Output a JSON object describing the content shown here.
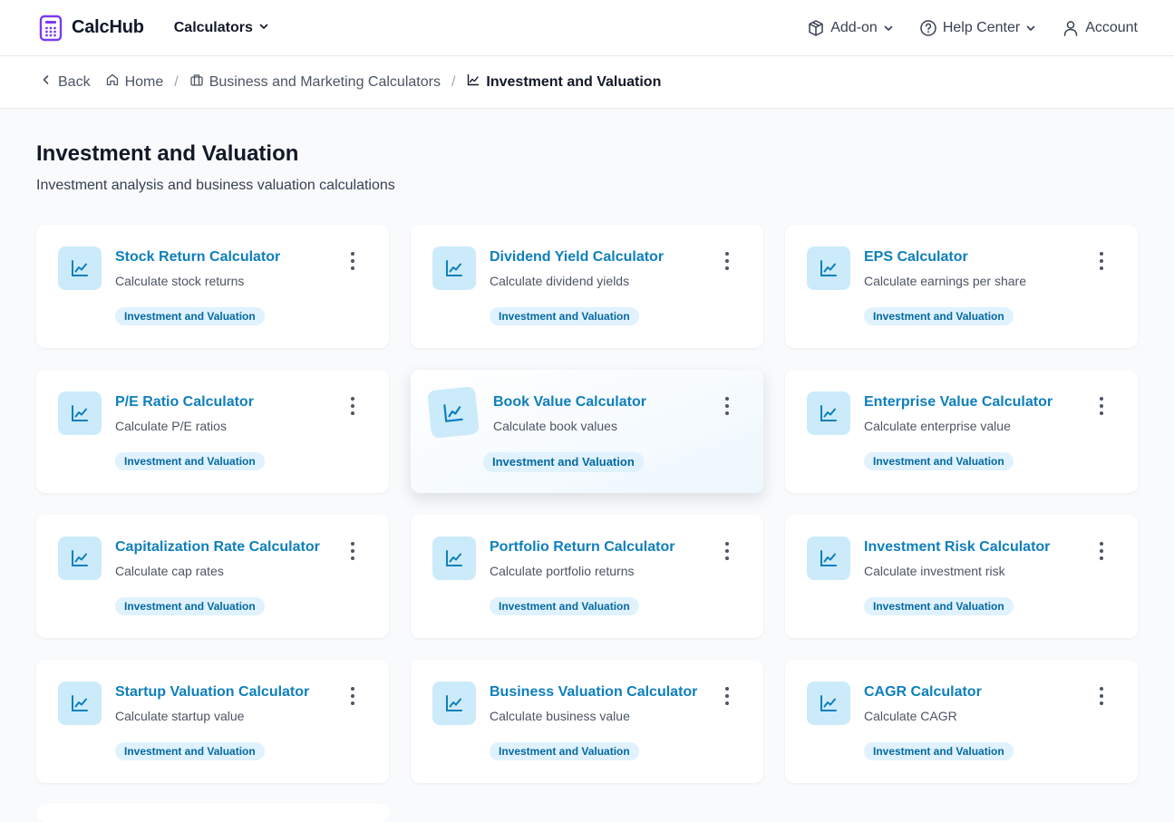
{
  "brand": {
    "name": "CalcHub",
    "accent": "#7c3aed"
  },
  "nav": {
    "calculators": "Calculators",
    "addon": "Add-on",
    "help": "Help Center",
    "account": "Account"
  },
  "breadcrumb": {
    "back": "Back",
    "home": "Home",
    "parent": "Business and Marketing Calculators",
    "current": "Investment and Valuation"
  },
  "page": {
    "title": "Investment and Valuation",
    "subtitle": "Investment analysis and business valuation calculations"
  },
  "cards": [
    {
      "title": "Stock Return Calculator",
      "desc": "Calculate stock returns",
      "tag": "Investment and Valuation"
    },
    {
      "title": "Dividend Yield Calculator",
      "desc": "Calculate dividend yields",
      "tag": "Investment and Valuation"
    },
    {
      "title": "EPS Calculator",
      "desc": "Calculate earnings per share",
      "tag": "Investment and Valuation"
    },
    {
      "title": "P/E Ratio Calculator",
      "desc": "Calculate P/E ratios",
      "tag": "Investment and Valuation"
    },
    {
      "title": "Book Value Calculator",
      "desc": "Calculate book values",
      "tag": "Investment and Valuation",
      "hover": true
    },
    {
      "title": "Enterprise Value Calculator",
      "desc": "Calculate enterprise value",
      "tag": "Investment and Valuation"
    },
    {
      "title": "Capitalization Rate Calculator",
      "desc": "Calculate cap rates",
      "tag": "Investment and Valuation"
    },
    {
      "title": "Portfolio Return Calculator",
      "desc": "Calculate portfolio returns",
      "tag": "Investment and Valuation"
    },
    {
      "title": "Investment Risk Calculator",
      "desc": "Calculate investment risk",
      "tag": "Investment and Valuation"
    },
    {
      "title": "Startup Valuation Calculator",
      "desc": "Calculate startup value",
      "tag": "Investment and Valuation"
    },
    {
      "title": "Business Valuation Calculator",
      "desc": "Calculate business value",
      "tag": "Investment and Valuation"
    },
    {
      "title": "CAGR Calculator",
      "desc": "Calculate CAGR",
      "tag": "Investment and Valuation"
    }
  ]
}
